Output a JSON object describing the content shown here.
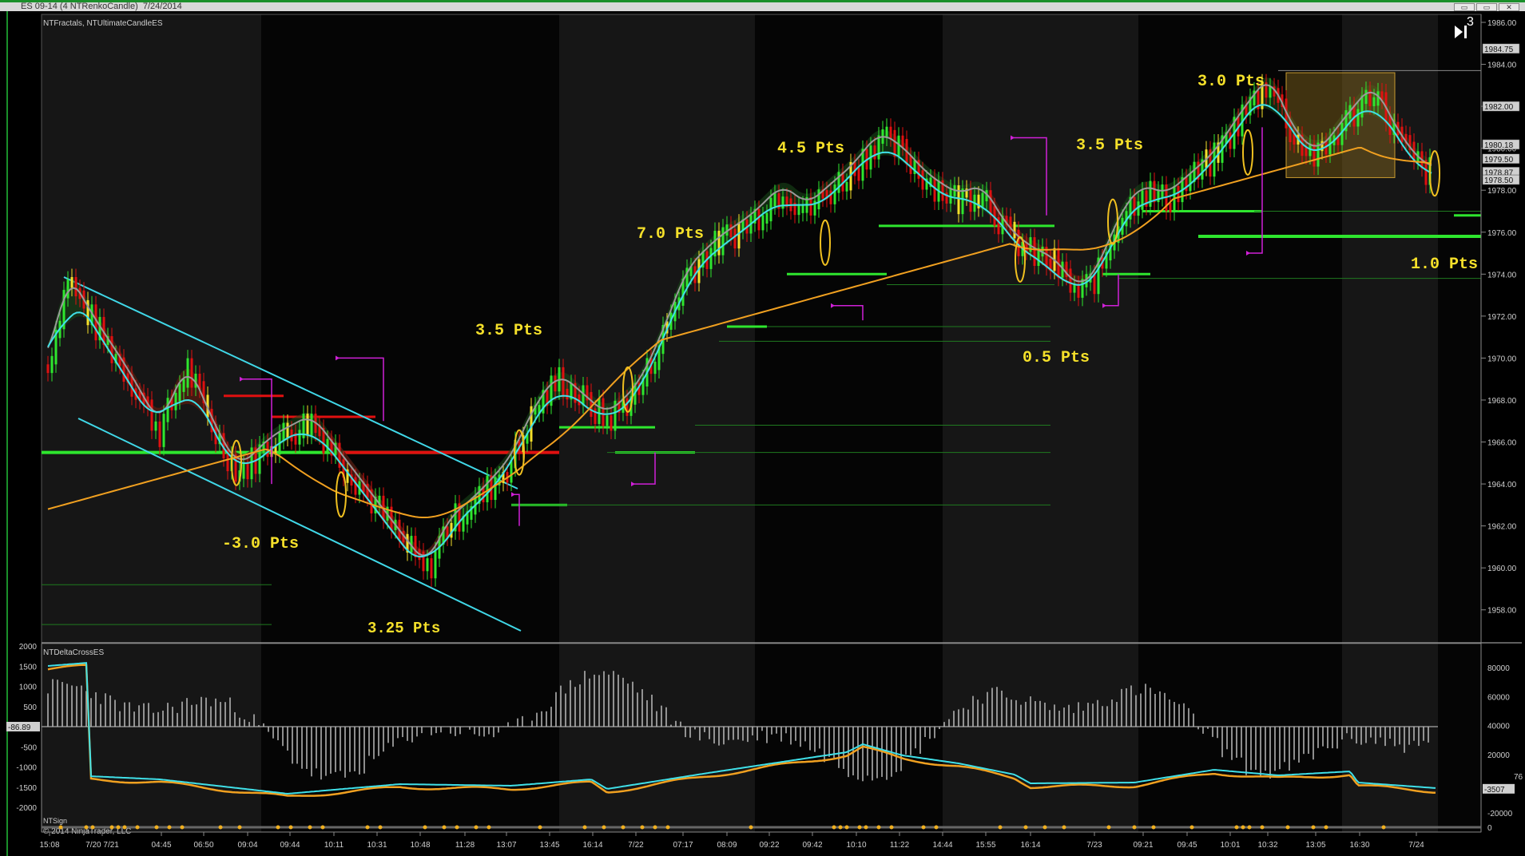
{
  "window": {
    "title": "ES 09-14 (4 NTRenkoCandle)  7/24/2014",
    "controls": [
      "▭",
      "▭",
      "✕"
    ]
  },
  "colors": {
    "bull": "#2ee62e",
    "bear": "#e01010",
    "neutral": "#f5e02a",
    "cyan": "#40e0e8",
    "orange": "#f0a020",
    "grey": "#9a9a9a",
    "magenta": "#d020d8",
    "trend": "#40d8e8"
  },
  "price_panel": {
    "indicator_title": "NTFractals, NTUltimateCandleES",
    "price_labels": [
      "1986.00",
      "1984.00",
      "1982.00",
      "1980.00",
      "1978.00",
      "1976.00",
      "1974.00",
      "1972.00",
      "1970.00",
      "1968.00",
      "1966.00",
      "1964.00",
      "1962.00",
      "1960.00",
      "1958.00"
    ],
    "price_tags": [
      "1984.75",
      "1982.00",
      "1980.18",
      "1979.50",
      "1978.87",
      "1978.50"
    ],
    "annotations": [
      {
        "text": "-3.0 Pts"
      },
      {
        "text": "3.25 Pts"
      },
      {
        "text": "3.5 Pts"
      },
      {
        "text": "7.0 Pts"
      },
      {
        "text": "4.5 Pts"
      },
      {
        "text": "0.5 Pts"
      },
      {
        "text": "3.5 Pts"
      },
      {
        "text": "3.0 Pts"
      },
      {
        "text": "1.0 Pts"
      }
    ],
    "corner_label": "3"
  },
  "delta_panel": {
    "indicator_title": "NTDeltaCrossES",
    "left_labels": [
      "2000",
      "1500",
      "1000",
      "500",
      "-86.89",
      "-500",
      "-1000",
      "-1500",
      "-2000"
    ],
    "right_labels": [
      "80000",
      "60000",
      "40000",
      "20000",
      "-3507",
      "-20000"
    ],
    "right_tag": "76",
    "signal_label": "NTSign",
    "copyright": "© 2014 NinjaTrader, LLC",
    "zero_label": "0"
  },
  "time_axis": {
    "labels": [
      "15:08",
      "7/20 7/21",
      "04:45",
      "06:50",
      "09:04",
      "09:44",
      "10:11",
      "10:31",
      "10:48",
      "11:28",
      "13:07",
      "13:45",
      "16:14",
      "7/22",
      "07:17",
      "08:09",
      "09:22",
      "09:42",
      "10:10",
      "11:22",
      "14:44",
      "15:55",
      "16:14",
      "7/23",
      "09:21",
      "09:45",
      "10:01",
      "10:32",
      "13:05",
      "16:30",
      "7/24"
    ]
  }
}
